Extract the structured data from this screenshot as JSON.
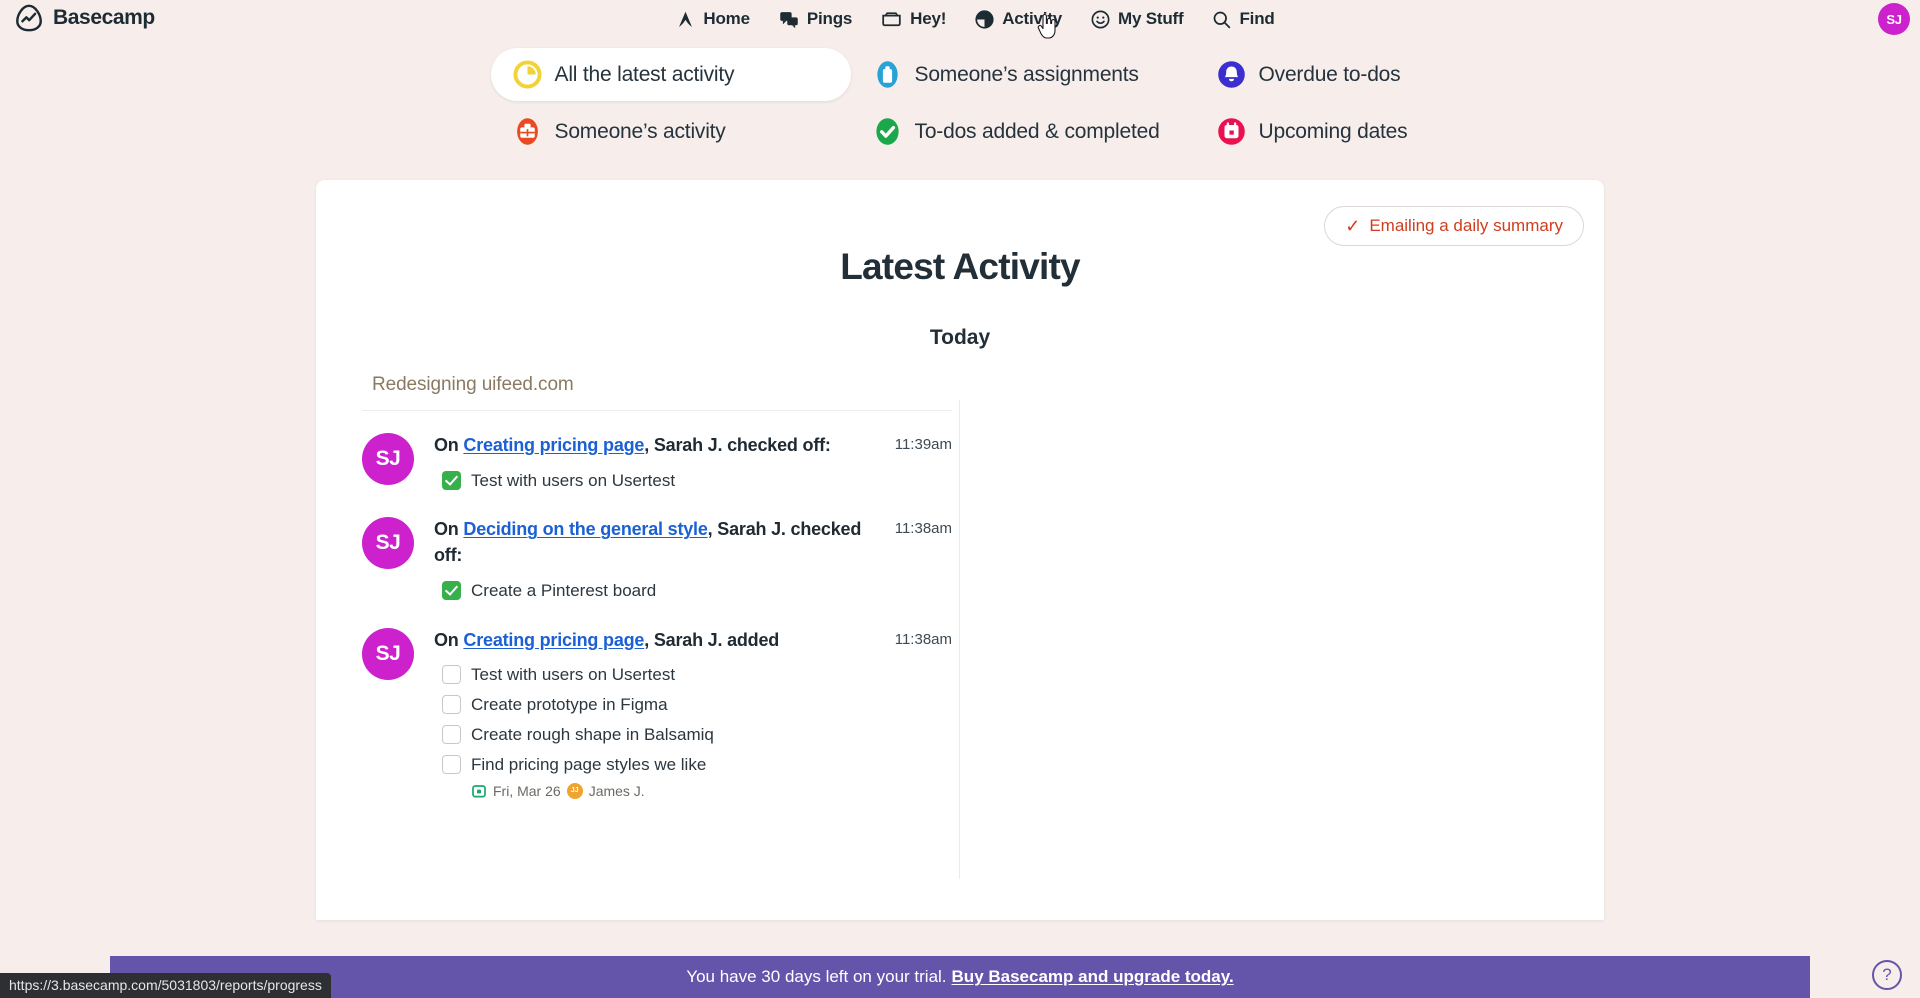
{
  "brand": {
    "name": "Basecamp",
    "logo_icon": "basecamp-logo-icon"
  },
  "nav": {
    "items": [
      {
        "label": "Home",
        "icon": "home-icon"
      },
      {
        "label": "Pings",
        "icon": "chat-bubbles-icon"
      },
      {
        "label": "Hey!",
        "icon": "inbox-tray-icon"
      },
      {
        "label": "Activity",
        "icon": "pie-clock-icon"
      },
      {
        "label": "My Stuff",
        "icon": "smiley-face-icon"
      },
      {
        "label": "Find",
        "icon": "search-icon"
      }
    ],
    "cursor_over": "Activity",
    "account_avatar": {
      "initials": "SJ",
      "color": "#cc21cc"
    }
  },
  "filters": [
    {
      "label": "All the latest activity",
      "icon": "clock-icon",
      "color": "#f2d335",
      "active": true
    },
    {
      "label": "Someone’s assignments",
      "icon": "clipboard-icon",
      "color": "#28a3d4",
      "active": false
    },
    {
      "label": "Overdue to-dos",
      "icon": "bell-icon",
      "color": "#3b2fcf",
      "active": false
    },
    {
      "label": "Someone’s activity",
      "icon": "briefcase-icon",
      "color": "#ea4a22",
      "active": false
    },
    {
      "label": "To-dos added & completed",
      "icon": "check-circle-icon",
      "color": "#1aa84a",
      "active": false
    },
    {
      "label": "Upcoming dates",
      "icon": "calendar-icon",
      "color": "#ea1150",
      "active": false
    }
  ],
  "card": {
    "summary_button": {
      "label": "Emailing a daily summary",
      "icon": "check-icon",
      "color": "#d13d1f"
    },
    "page_title": "Latest Activity",
    "day_heading": "Today",
    "project_name": "Redesigning uifeed.com",
    "entries": [
      {
        "avatar": {
          "initials": "SJ",
          "color": "#cc21cc"
        },
        "prefix": "On ",
        "link": "Creating pricing page",
        "suffix": ", Sarah J. checked off:",
        "time": "11:39am",
        "todos": [
          {
            "label": "Test with users on Usertest",
            "checked": true
          }
        ]
      },
      {
        "avatar": {
          "initials": "SJ",
          "color": "#cc21cc"
        },
        "prefix": "On ",
        "link": "Deciding on the general style",
        "suffix": ", Sarah J. checked off:",
        "time": "11:38am",
        "todos": [
          {
            "label": "Create a Pinterest board",
            "checked": true
          }
        ]
      },
      {
        "avatar": {
          "initials": "SJ",
          "color": "#cc21cc"
        },
        "prefix": "On ",
        "link": "Creating pricing page",
        "suffix": ", Sarah J. added",
        "time": "11:38am",
        "todos": [
          {
            "label": "Test with users on Usertest",
            "checked": false
          },
          {
            "label": "Create prototype in Figma",
            "checked": false
          },
          {
            "label": "Create rough shape in Balsamiq",
            "checked": false
          },
          {
            "label": "Find pricing page styles we like",
            "checked": false,
            "meta": {
              "date": "Fri, Mar 26",
              "date_icon": "calendar-icon",
              "assignee": "James J.",
              "assignee_initials": "JJ",
              "assignee_color": "#f0a32e"
            }
          }
        ]
      }
    ]
  },
  "trial_banner": {
    "text": "You have 30 days left on your trial.",
    "link": "Buy Basecamp and upgrade today.",
    "color": "#6455ab"
  },
  "help_button": {
    "label": "?"
  },
  "status_bar": {
    "url": "https://3.basecamp.com/5031803/reports/progress"
  }
}
